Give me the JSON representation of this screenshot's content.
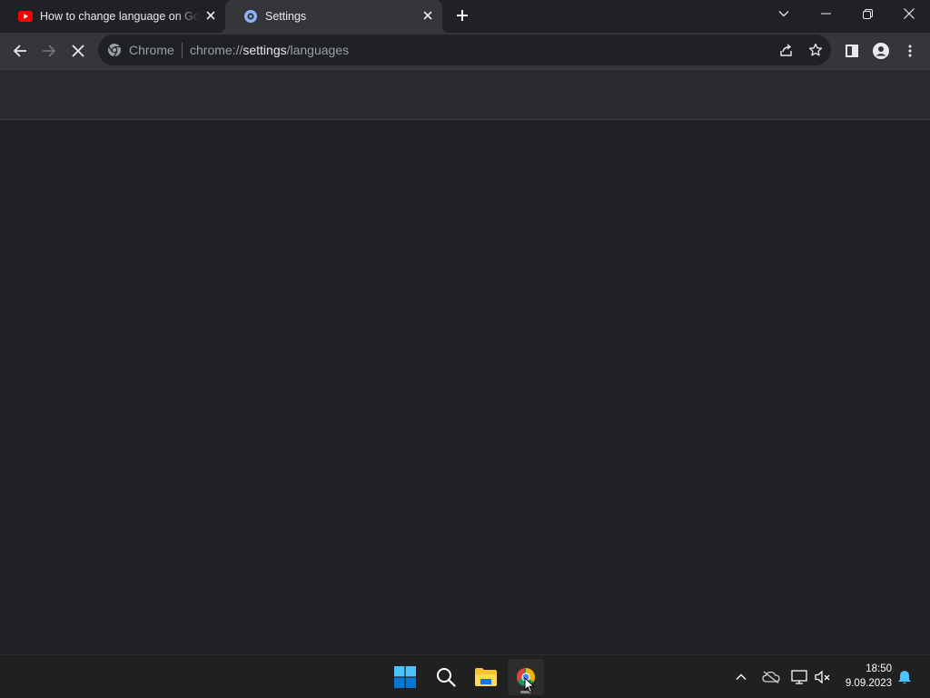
{
  "tabs": [
    {
      "title": "How to change language on Google",
      "icon": "youtube-icon",
      "active": false
    },
    {
      "title": "Settings",
      "icon": "settings-gear-icon",
      "active": true
    }
  ],
  "omnibox": {
    "site_chip": "Chrome",
    "url_scheme": "chrome://",
    "url_host": "settings",
    "url_path": "/languages"
  },
  "taskbar": {
    "apps": [
      "windows-start",
      "search",
      "file-explorer",
      "google-chrome"
    ],
    "clock": {
      "time": "18:50",
      "date": "9.09.2023"
    }
  },
  "colors": {
    "titlebar": "#202124",
    "toolbar": "#35363a",
    "page": "#202124",
    "page_header": "#292a2d",
    "taskbar": "#202020",
    "youtube_red": "#ff0000",
    "settings_blue": "#8ab4f8"
  }
}
